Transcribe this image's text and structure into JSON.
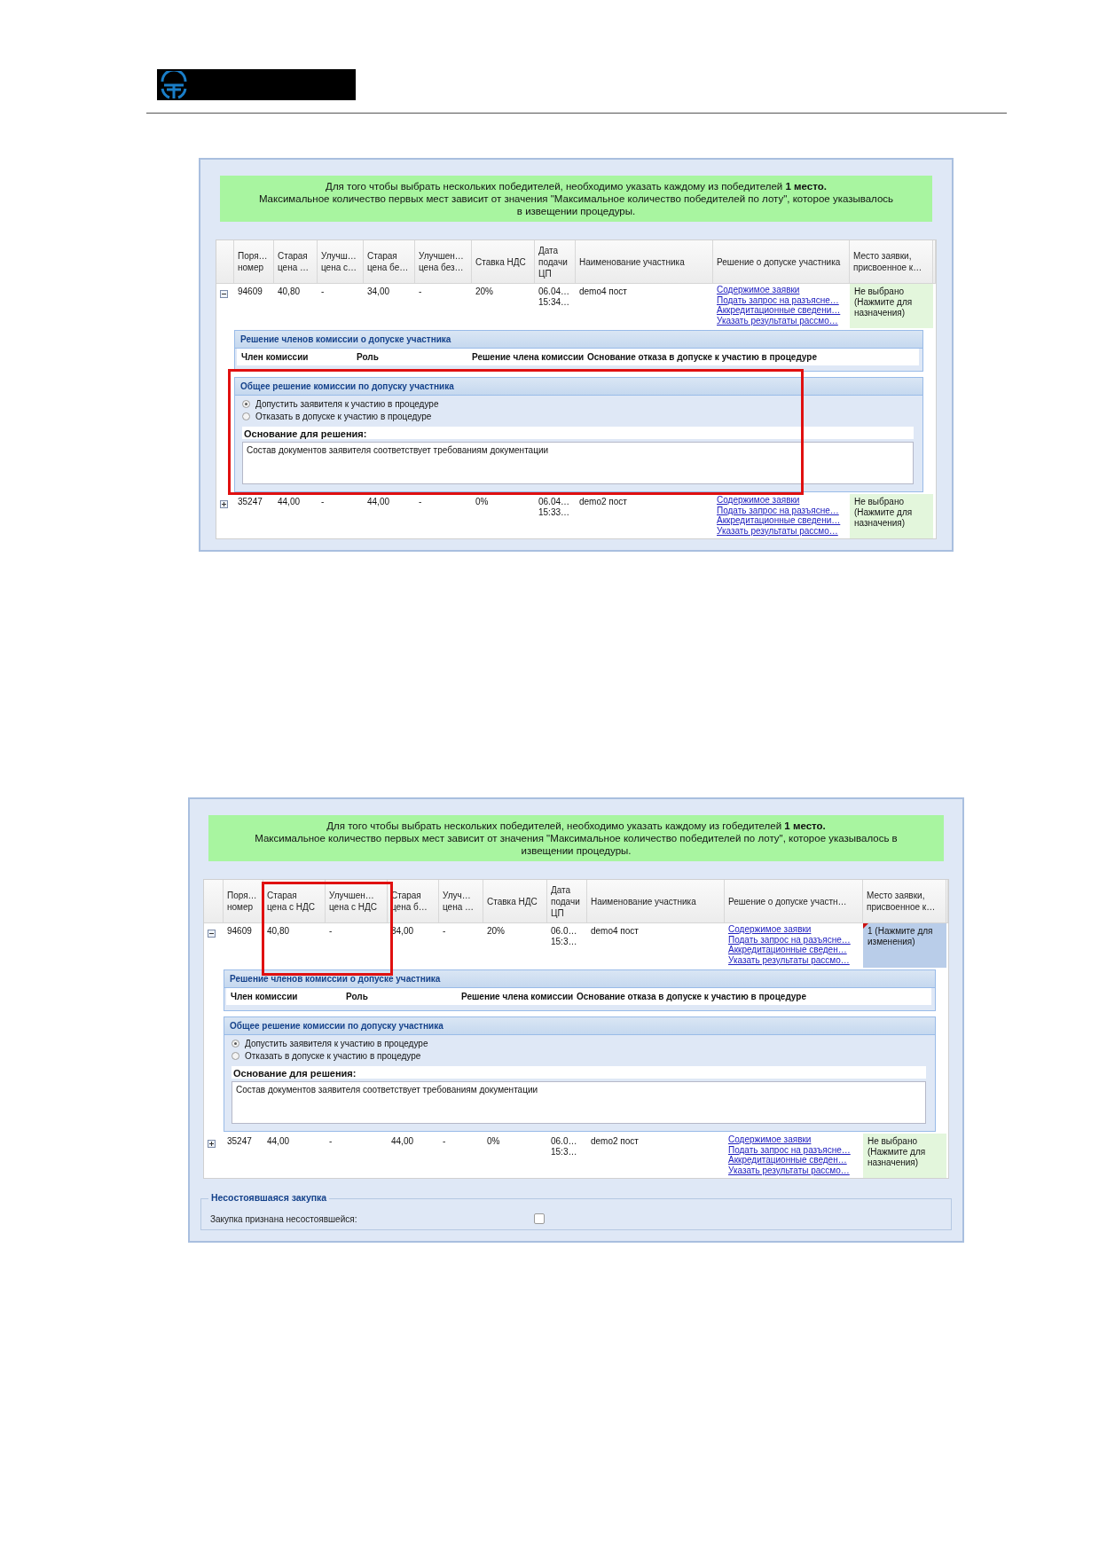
{
  "shots": [
    {
      "notice": [
        "Для того чтобы выбрать нескольких победителей, необходимо указать каждому из победителей **1 место.**",
        "Максимальное количество первых мест зависит от значения \"Максимальное количество победителей по лоту\", которое указывалось в извещении процедуры."
      ],
      "columns": [
        {
          "label": "Поря…\nномер",
          "highlighted": false
        },
        {
          "label": "Старая\nцена …",
          "highlighted": false
        },
        {
          "label": "Улучш…\nцена с…",
          "highlighted": false
        },
        {
          "label": "Старая\nцена бе…",
          "highlighted": false
        },
        {
          "label": "Улучшен…\nцена без…",
          "highlighted": false
        },
        {
          "label": "Ставка НДС",
          "highlighted": false
        },
        {
          "label": "Дата\nподачи\nЦП",
          "highlighted": false
        },
        {
          "label": "Наименование участника",
          "highlighted": false
        },
        {
          "label": "Решение о допуске участника",
          "highlighted": false
        },
        {
          "label": "Место заявки,\nприсвоенное к…",
          "highlighted": false
        }
      ],
      "rows": [
        {
          "expanded": true,
          "cells": [
            "94609",
            "40,80",
            "-",
            "34,00",
            "-",
            "20%",
            "06.04…\n15:34…",
            "demo4 пост"
          ],
          "links": [
            "Содержимое заявки",
            "Подать запрос на разъясне…",
            "Аккредитационные сведени…",
            "Указать результаты рассмо…"
          ],
          "place": {
            "text": "Не выбрано (Нажмите для назначения)",
            "assigned": false
          }
        },
        {
          "expanded": false,
          "cells": [
            "35247",
            "44,00",
            "-",
            "44,00",
            "-",
            "0%",
            "06.04…\n15:33…",
            "demo2 пост"
          ],
          "links": [
            "Содержимое заявки",
            "Подать запрос на разъясне…",
            "Аккредитационные сведени…",
            "Указать результаты рассмо…"
          ],
          "place": {
            "text": "Не выбрано (Нажмите для назначения)",
            "assigned": false
          }
        }
      ],
      "members_panel": {
        "title": "Решение членов комиссии о допуске участника",
        "columns": [
          "Член комиссии",
          "Роль",
          "Решение члена комиссии",
          "Основание отказа в допуске к участию в процедуре"
        ]
      },
      "decision_panel": {
        "title": "Общее решение комиссии по допуску участника",
        "highlighted": true,
        "options": [
          {
            "label": "Допустить заявителя к участию в процедуре",
            "selected": true
          },
          {
            "label": "Отказать в допуске к участию в процедуре",
            "selected": false
          }
        ],
        "reason_label": "Основание для решения:",
        "reason_value": "Состав документов заявителя соответствует требованиям документации"
      }
    },
    {
      "notice": [
        "Для того чтобы выбрать нескольких победителей, необходимо указать каждому из гобедителей **1 место.**",
        "Максимальное количество первых мест зависит от значения \"Максимальное количество победителей по лоту\", которое указывалось в извещении процедуры."
      ],
      "columns": [
        {
          "label": "Поря…\nномер",
          "highlighted": false
        },
        {
          "label": "Старая\nцена с НДС",
          "highlighted": true
        },
        {
          "label": "Улучшен…\nцена с НДС",
          "highlighted": true
        },
        {
          "label": "Старая\nцена б…",
          "highlighted": false
        },
        {
          "label": "Улуч…\nцена …",
          "highlighted": false
        },
        {
          "label": "Ставка НДС",
          "highlighted": false
        },
        {
          "label": "Дата\nподачи\nЦП",
          "highlighted": false
        },
        {
          "label": "Наименование участника",
          "highlighted": false
        },
        {
          "label": "Решение о допуске участн…",
          "highlighted": false
        },
        {
          "label": "Место заявки,\nприсвоенное к…",
          "highlighted": false
        }
      ],
      "rows": [
        {
          "expanded": true,
          "cells": [
            "94609",
            "40,80",
            "-",
            "34,00",
            "-",
            "20%",
            "06.0…\n15:3…",
            "demo4 пост"
          ],
          "links": [
            "Содержимое заявки",
            "Подать запрос на разъясне…",
            "Аккредитационные сведен…",
            "Указать результаты рассмо…"
          ],
          "place": {
            "text": "1 (Нажмите для изменения)",
            "assigned": true
          }
        },
        {
          "expanded": false,
          "cells": [
            "35247",
            "44,00",
            "-",
            "44,00",
            "-",
            "0%",
            "06.0…\n15:3…",
            "demo2 пост"
          ],
          "links": [
            "Содержимое заявки",
            "Подать запрос на разъясне…",
            "Аккредитационные сведен…",
            "Указать результаты рассмо…"
          ],
          "place": {
            "text": "Не выбрано (Нажмите для назначения)",
            "assigned": false
          }
        }
      ],
      "members_panel": {
        "title": "Решение членов комиссии о допуске участника",
        "columns": [
          "Член комиссии",
          "Роль",
          "Решение члена комиссии",
          "Основание отказа в допуске к участию в процедуре"
        ]
      },
      "decision_panel": {
        "title": "Общее решение комиссии по допуску участника",
        "highlighted": false,
        "options": [
          {
            "label": "Допустить заявителя к участию в процедуре",
            "selected": true
          },
          {
            "label": "Отказать в допуске к участию в процедуре",
            "selected": false
          }
        ],
        "reason_label": "Основание для решения:",
        "reason_value": "Состав документов заявителя соответствует требованиям документации"
      },
      "failed_section": {
        "title": "Несостоявшаяся закупка",
        "label": "Закупка признана несостоявшейся:",
        "checked": false
      }
    }
  ]
}
